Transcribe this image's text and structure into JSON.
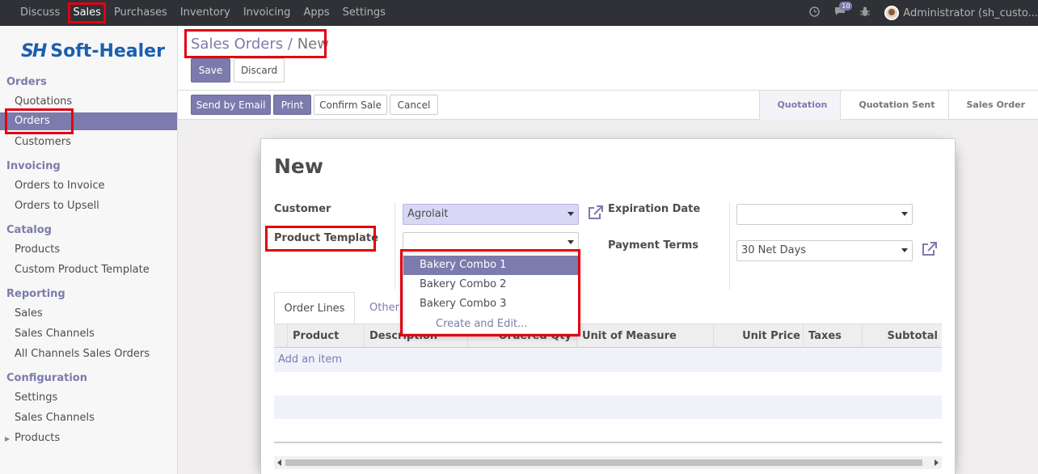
{
  "navbar": {
    "menu": [
      "Discuss",
      "Sales",
      "Purchases",
      "Inventory",
      "Invoicing",
      "Apps",
      "Settings"
    ],
    "active": "Sales",
    "chat_count": "10",
    "user": "Administrator (sh_custo..."
  },
  "sidebar": {
    "logo_mark": "SH",
    "logo_text": "Soft-Healer",
    "sections": [
      {
        "title": "Orders",
        "items": [
          "Quotations",
          "Orders",
          "Customers"
        ]
      },
      {
        "title": "Invoicing",
        "items": [
          "Orders to Invoice",
          "Orders to Upsell"
        ]
      },
      {
        "title": "Catalog",
        "items": [
          "Products",
          "Custom Product Template"
        ]
      },
      {
        "title": "Reporting",
        "items": [
          "Sales",
          "Sales Channels",
          "All Channels Sales Orders"
        ]
      },
      {
        "title": "Configuration",
        "items": [
          "Settings",
          "Sales Channels",
          "Products"
        ]
      }
    ]
  },
  "breadcrumb": {
    "parent": "Sales Orders",
    "separator": "/",
    "current": "New"
  },
  "buttons": {
    "save": "Save",
    "discard": "Discard",
    "send_email": "Send by Email",
    "print": "Print",
    "confirm": "Confirm Sale",
    "cancel": "Cancel"
  },
  "states": [
    "Quotation",
    "Quotation Sent",
    "Sales Order"
  ],
  "form": {
    "title": "New",
    "customer_label": "Customer",
    "customer_value": "Agrolait",
    "template_label": "Product Template",
    "template_value": "",
    "expiration_label": "Expiration Date",
    "expiration_value": "",
    "payment_label": "Payment Terms",
    "payment_value": "30 Net Days"
  },
  "dropdown": {
    "options": [
      "Bakery Combo 1",
      "Bakery Combo 2",
      "Bakery Combo 3"
    ],
    "create": "Create and Edit..."
  },
  "tabs": [
    "Order Lines",
    "Other Information"
  ],
  "table": {
    "columns": [
      "Product",
      "Description",
      "Ordered Qty",
      "Unit of Measure",
      "Unit Price",
      "Taxes",
      "Subtotal"
    ],
    "add_item": "Add an item"
  },
  "colors": {
    "accent": "#7c7bad",
    "highlight": "#e3000f",
    "navbar": "#2f3136"
  }
}
